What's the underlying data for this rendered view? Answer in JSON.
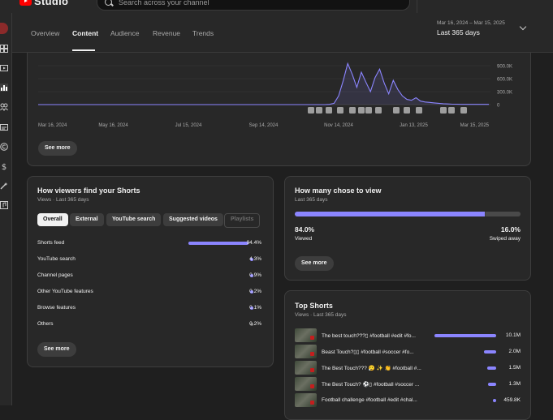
{
  "app": {
    "logo_text": "Studio",
    "search_placeholder": "Search across your channel"
  },
  "tabs": [
    {
      "label": "Overview",
      "active": false
    },
    {
      "label": "Content",
      "active": true
    },
    {
      "label": "Audience",
      "active": false
    },
    {
      "label": "Revenue",
      "active": false
    },
    {
      "label": "Trends",
      "active": false
    }
  ],
  "date_range": {
    "dates": "Mar 16, 2024 – Mar 15, 2025",
    "label": "Last 365 days"
  },
  "views_chart": {
    "see_more": "See more",
    "chart_data": {
      "type": "line",
      "series": [
        {
          "values": [
            0,
            0,
            0,
            0,
            0,
            0,
            0,
            0,
            0,
            0,
            0,
            0,
            0,
            0,
            0,
            0,
            0,
            0,
            0,
            0,
            0,
            0,
            0,
            0,
            0,
            0,
            0,
            0,
            0,
            0,
            0,
            0,
            0,
            0,
            0,
            0,
            0,
            0,
            0,
            0,
            0,
            0,
            0,
            0,
            0,
            0,
            0,
            0,
            0,
            0,
            0,
            0,
            0,
            0,
            0,
            0,
            0,
            0,
            0,
            0,
            0,
            0,
            0,
            0,
            5,
            30,
            200,
            550,
            950,
            700,
            400,
            750,
            520,
            300,
            620,
            820,
            500,
            250,
            560,
            350,
            200,
            120,
            100,
            160,
            80,
            60,
            50,
            40,
            30,
            20,
            15,
            10,
            10,
            5,
            5,
            5,
            5,
            5,
            5,
            5
          ]
        }
      ],
      "color": "#8b85ff",
      "x_ticks": [
        "Mar 16, 2024",
        "May 16, 2024",
        "Jul 15, 2024",
        "Sep 14, 2024",
        "Nov 14, 2024",
        "Jan 13, 2025",
        "Mar 15, 2025"
      ],
      "y_ticks": [
        "900.0K",
        "600.0K",
        "300.0K",
        "0"
      ],
      "ylim": [
        0,
        1050
      ]
    }
  },
  "traffic_sources": {
    "title": "How viewers find your Shorts",
    "subtitle": "Views · Last 365 days",
    "chips": [
      {
        "label": "Overall",
        "state": "selected"
      },
      {
        "label": "External",
        "state": "normal"
      },
      {
        "label": "YouTube search",
        "state": "normal"
      },
      {
        "label": "Suggested videos",
        "state": "normal"
      },
      {
        "label": "Playlists",
        "state": "disabled"
      }
    ],
    "rows": [
      {
        "label": "Shorts feed",
        "value": "94.4%",
        "pct": 94.4,
        "color": "#8b85ff"
      },
      {
        "label": "YouTube search",
        "value": "4.3%",
        "pct": 4.3,
        "color": "#8b85ff"
      },
      {
        "label": "Channel pages",
        "value": "0.9%",
        "pct": 0.9,
        "color": "#8b85ff"
      },
      {
        "label": "Other YouTube features",
        "value": "0.2%",
        "pct": 0.2,
        "color": "#8b85ff"
      },
      {
        "label": "Browse features",
        "value": "0.1%",
        "pct": 0.1,
        "color": "#8b85ff"
      },
      {
        "label": "Others",
        "value": "0.2%",
        "pct": 0.2,
        "color": "#6d6d6d"
      }
    ],
    "see_more": "See more"
  },
  "chose_to_view": {
    "title": "How many chose to view",
    "subtitle": "Last 365 days",
    "viewed_pct": "84.0%",
    "viewed_label": "Viewed",
    "swiped_pct": "16.0%",
    "swiped_label": "Swiped away",
    "viewed_fraction": 0.84,
    "see_more": "See more"
  },
  "top_shorts": {
    "title": "Top Shorts",
    "subtitle": "Views · Last 365 days",
    "rows": [
      {
        "title": "The best touch???▯ #football #edit #fo...",
        "value": "10.1M",
        "fraction": 1.0
      },
      {
        "title": "Beast Touch?▯▯ #football #soccer #fo...",
        "value": "2.0M",
        "fraction": 0.2
      },
      {
        "title": "The Best Touch??? 😮‍💨 ✨ 👏 #football #...",
        "value": "1.5M",
        "fraction": 0.15
      },
      {
        "title": "The Best Touch? ⚽▯ #football #soccer ...",
        "value": "1.3M",
        "fraction": 0.13
      },
      {
        "title": "Football challenge #football #edit #chal...",
        "value": "459.8K",
        "fraction": 0.045
      }
    ]
  }
}
